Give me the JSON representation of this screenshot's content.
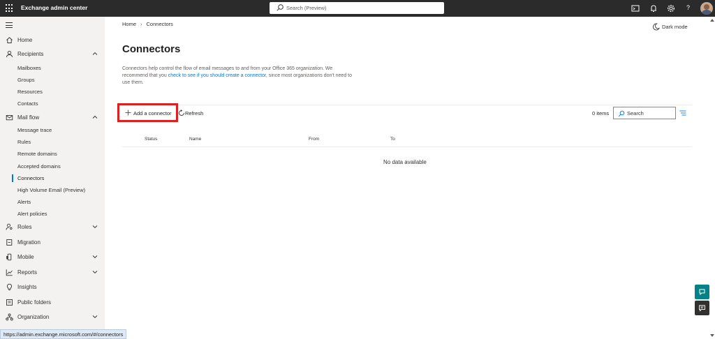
{
  "app": {
    "title": "Exchange admin center"
  },
  "topbar": {
    "search_placeholder": "Search (Preview)",
    "help": "?"
  },
  "sidebar": {
    "home": "Home",
    "recipients": "Recipients",
    "recipients_items": [
      "Mailboxes",
      "Groups",
      "Resources",
      "Contacts"
    ],
    "mailflow": "Mail flow",
    "mailflow_items": [
      "Message trace",
      "Rules",
      "Remote domains",
      "Accepted domains",
      "Connectors",
      "High Volume Email (Preview)",
      "Alerts",
      "Alert policies"
    ],
    "roles": "Roles",
    "migration": "Migration",
    "mobile": "Mobile",
    "reports": "Reports",
    "insights": "Insights",
    "public_folders": "Public folders",
    "organization": "Organization"
  },
  "breadcrumb": {
    "home": "Home",
    "current": "Connectors"
  },
  "darkmode": "Dark mode",
  "page": {
    "title": "Connectors",
    "desc_part1": "Connectors help control the flow of email messages to and from your Office 365 organization. We recommend that you ",
    "desc_link": "check to see if you should create a connector",
    "desc_part2": ", since most organizations don't need to use them."
  },
  "toolbar": {
    "add_label": "Add a connector",
    "refresh_label": "Refresh",
    "items_count": "0 items",
    "search_placeholder": "Search"
  },
  "table": {
    "columns": [
      "Status",
      "Name",
      "From",
      "To"
    ],
    "empty": "No data available"
  },
  "status_url": "https://admin.exchange.microsoft.com/#/connectors",
  "colors": {
    "accent": "#0078d4",
    "highlight": "#e01e1e",
    "topbar": "#2b2b2b"
  }
}
